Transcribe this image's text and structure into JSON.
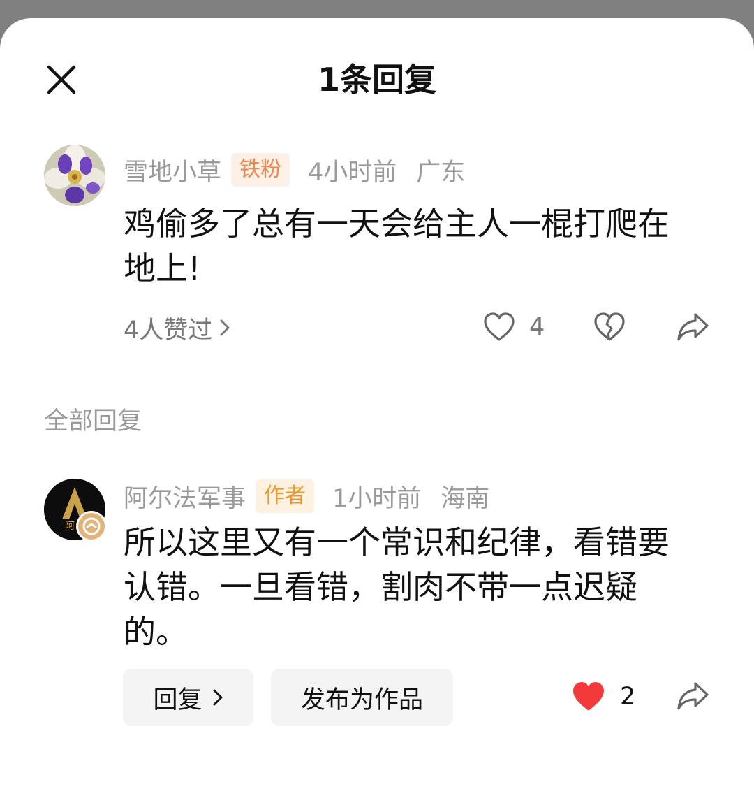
{
  "header": {
    "title": "1条回复"
  },
  "main_comment": {
    "username": "雪地小草",
    "badge": "铁粉",
    "time": "4小时前",
    "location": "广东",
    "text": "鸡偷多了总有一天会给主人一棍打爬在地上!",
    "likers_text": "4人赞过",
    "like_count": "4"
  },
  "section_label": "全部回复",
  "reply": {
    "username": "阿尔法军事",
    "badge": "作者",
    "time": "1小时前",
    "location": "海南",
    "text": "所以这里又有一个常识和纪律，看错要认错。一旦看错，割肉不带一点迟疑的。",
    "reply_button": "回复",
    "publish_button": "发布为作品",
    "like_count": "2",
    "liked": true
  },
  "colors": {
    "fan_badge": "#f0884e",
    "author_badge": "#e89a2a",
    "liked_heart": "#f23a3a"
  }
}
